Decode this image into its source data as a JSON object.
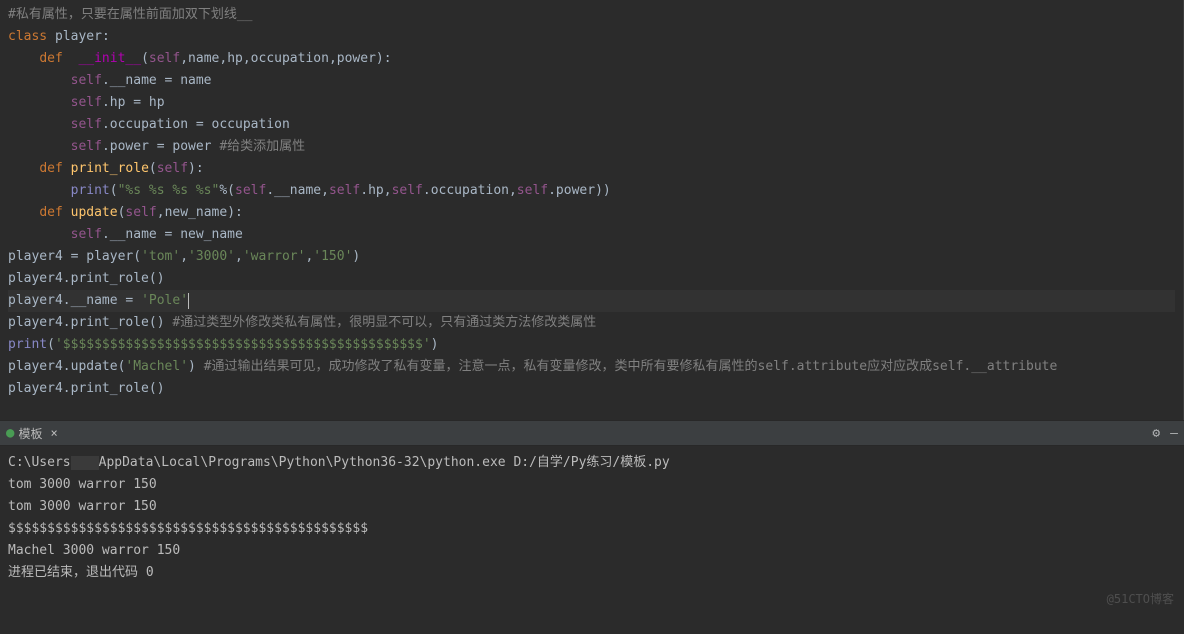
{
  "code": {
    "l1_comment": "#私有属性，只要在属性前面加双下划线__",
    "l2_kw_class": "class ",
    "l2_name": "player",
    "l2_colon": ":",
    "l3_indent": "    ",
    "l3_kw_def": "def  ",
    "l3_fn": "__init__",
    "l3_paren_open": "(",
    "l3_self": "self",
    "l3_comma1": ",",
    "l3_p1": "name",
    "l3_comma2": ",",
    "l3_p2": "hp",
    "l3_comma3": ",",
    "l3_p3": "occupation",
    "l3_comma4": ",",
    "l3_p4": "power",
    "l3_paren_close": "):",
    "l4_indent": "        ",
    "l4_self": "self",
    "l4_dot": ".",
    "l4_attr": "__name = name",
    "l5_indent": "        ",
    "l5_self": "self",
    "l5_dot": ".",
    "l5_attr": "hp = hp",
    "l6_indent": "        ",
    "l6_self": "self",
    "l6_dot": ".",
    "l6_attr": "occupation = occupation",
    "l7_indent": "        ",
    "l7_self": "self",
    "l7_dot": ".",
    "l7_attr": "power = power ",
    "l7_comment": "#给类添加属性",
    "l8_indent": "    ",
    "l8_kw_def": "def ",
    "l8_fn": "print_role",
    "l8_paren_open": "(",
    "l8_self": "self",
    "l8_paren_close": "):",
    "l9_indent": "        ",
    "l9_print": "print",
    "l9_paren_open": "(",
    "l9_str": "\"%s %s %s %s\"",
    "l9_pct": "%(",
    "l9_self1": "self",
    "l9_a1": ".__name",
    "l9_c1": ",",
    "l9_self2": "self",
    "l9_a2": ".hp",
    "l9_c2": ",",
    "l9_self3": "self",
    "l9_a3": ".occupation",
    "l9_c3": ",",
    "l9_self4": "self",
    "l9_a4": ".power))",
    "l10_indent": "    ",
    "l10_kw_def": "def ",
    "l10_fn": "update",
    "l10_paren_open": "(",
    "l10_self": "self",
    "l10_c": ",",
    "l10_p": "new_name",
    "l10_paren_close": "):",
    "l11_indent": "        ",
    "l11_self": "self",
    "l11_rest": ".__name = new_name",
    "l12_var": "player4 = player(",
    "l12_s1": "'tom'",
    "l12_c1": ",",
    "l12_s2": "'3000'",
    "l12_c2": ",",
    "l12_s3": "'warror'",
    "l12_c3": ",",
    "l12_s4": "'150'",
    "l12_close": ")",
    "l13": "player4.print_role()",
    "l14_a": "player4.__name = ",
    "l14_s": "'Pole'",
    "l15_a": "player4.print_role() ",
    "l15_comment": "#通过类型外修改类私有属性，很明显不可以，只有通过类方法修改类属性",
    "l16_print": "print",
    "l16_open": "(",
    "l16_s": "'$$$$$$$$$$$$$$$$$$$$$$$$$$$$$$$$$$$$$$$$$$$$$$'",
    "l16_close": ")",
    "l17_a": "player4.update(",
    "l17_s": "'Machel'",
    "l17_b": ") ",
    "l17_comment": "#通过输出结果可见，成功修改了私有变量，注意一点，私有变量修改，类中所有要修私有属性的self.attribute应对应改成self.__attribute",
    "l18": "player4.print_role()"
  },
  "panel": {
    "tab_name": "模板",
    "tab_close": "×"
  },
  "console": {
    "l1_a": "C:\\Users",
    "l1_b": "AppData\\Local\\Programs\\Python\\Python36-32\\python.exe D:/自学/Py练习/模板.py",
    "l2": "tom 3000 warror 150",
    "l3": "tom 3000 warror 150",
    "l4": "$$$$$$$$$$$$$$$$$$$$$$$$$$$$$$$$$$$$$$$$$$$$$$",
    "l5": "Machel 3000 warror 150",
    "l6": "",
    "l7": "进程已结束，退出代码 0"
  },
  "watermark": "@51CTO博客"
}
